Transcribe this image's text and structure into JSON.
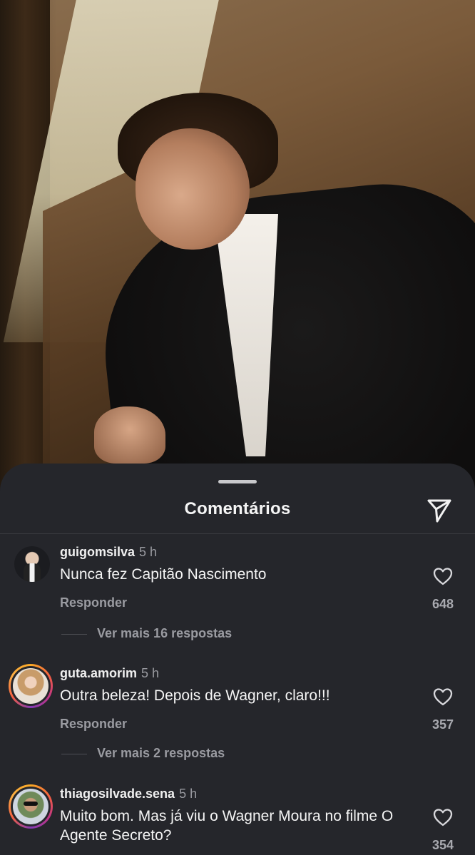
{
  "sheet": {
    "title": "Comentários",
    "share_icon": "send-icon"
  },
  "comments": [
    {
      "username": "guigomsilva",
      "time": "5 h",
      "text": "Nunca fez Capitão Nascimento",
      "reply_label": "Responder",
      "likes": "648",
      "more_replies": "Ver mais 16 respostas",
      "avatar_ring": false
    },
    {
      "username": "guta.amorim",
      "time": "5 h",
      "text": "Outra beleza! Depois de Wagner, claro!!!",
      "reply_label": "Responder",
      "likes": "357",
      "more_replies": "Ver mais 2 respostas",
      "avatar_ring": true
    },
    {
      "username": "thiagosilvade.sena",
      "time": "5 h",
      "text": "Muito bom. Mas já viu o Wagner Moura no filme O Agente Secreto?",
      "likes": "354",
      "avatar_ring": true
    }
  ],
  "colors": {
    "sheet_bg": "#25262b",
    "secondary_text": "#9a9ba1",
    "story_ring": [
      "#f9a825",
      "#c13584",
      "#833ab4"
    ]
  }
}
